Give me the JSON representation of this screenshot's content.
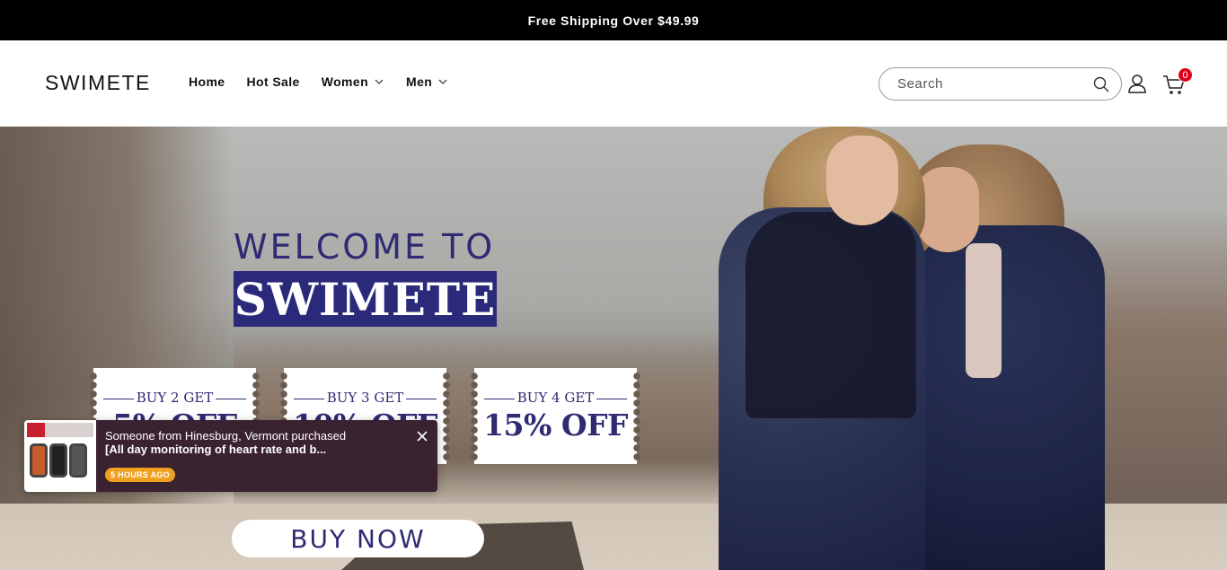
{
  "announcement": {
    "text": "Free Shipping Over $49.99"
  },
  "header": {
    "logo": "SWIMETE",
    "nav": [
      {
        "label": "Home",
        "has_dropdown": false
      },
      {
        "label": "Hot Sale",
        "has_dropdown": false
      },
      {
        "label": "Women",
        "has_dropdown": true
      },
      {
        "label": "Men",
        "has_dropdown": true
      }
    ],
    "search": {
      "placeholder": "Search",
      "value": ""
    },
    "cart": {
      "count": "0",
      "badge_color": "#e0001b"
    }
  },
  "hero": {
    "welcome": "WELCOME TO",
    "brand": "SWIMETE",
    "offers": [
      {
        "top": "BUY 2 GET",
        "off": "5% OFF"
      },
      {
        "top": "BUY 3 GET",
        "off": "10% OFF"
      },
      {
        "top": "BUY 4 GET",
        "off": "15% OFF"
      }
    ],
    "cta": "BUY NOW",
    "accent_color": "#2b2a7a"
  },
  "toast": {
    "line1": "Someone from Hinesburg, Vermont purchased",
    "line2": "[All day monitoring of heart rate and b...",
    "time": "5 HOURS AGO",
    "background": "#3b2230",
    "time_badge_color": "#f0a020"
  },
  "icons": [
    "search-icon",
    "account-icon",
    "cart-icon",
    "chevron-down-icon",
    "close-icon"
  ]
}
